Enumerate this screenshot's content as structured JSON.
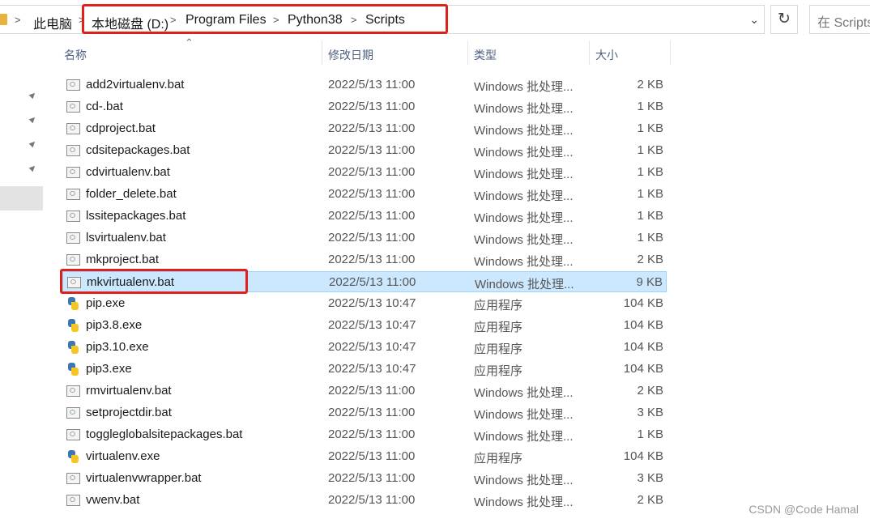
{
  "address": {
    "root": "此电脑",
    "crumbs": [
      "本地磁盘 (D:)",
      "Program Files",
      "Python38",
      "Scripts"
    ]
  },
  "search": {
    "placeholder": "在 Scripts"
  },
  "columns": {
    "name": "名称",
    "date": "修改日期",
    "type": "类型",
    "size": "大小"
  },
  "files": [
    {
      "name": "add2virtualenv.bat",
      "date": "2022/5/13 11:00",
      "type": "Windows 批处理...",
      "size": "2 KB",
      "icon": "bat-file-icon"
    },
    {
      "name": "cd-.bat",
      "date": "2022/5/13 11:00",
      "type": "Windows 批处理...",
      "size": "1 KB",
      "icon": "bat-file-icon"
    },
    {
      "name": "cdproject.bat",
      "date": "2022/5/13 11:00",
      "type": "Windows 批处理...",
      "size": "1 KB",
      "icon": "bat-file-icon"
    },
    {
      "name": "cdsitepackages.bat",
      "date": "2022/5/13 11:00",
      "type": "Windows 批处理...",
      "size": "1 KB",
      "icon": "bat-file-icon"
    },
    {
      "name": "cdvirtualenv.bat",
      "date": "2022/5/13 11:00",
      "type": "Windows 批处理...",
      "size": "1 KB",
      "icon": "bat-file-icon"
    },
    {
      "name": "folder_delete.bat",
      "date": "2022/5/13 11:00",
      "type": "Windows 批处理...",
      "size": "1 KB",
      "icon": "bat-file-icon"
    },
    {
      "name": "lssitepackages.bat",
      "date": "2022/5/13 11:00",
      "type": "Windows 批处理...",
      "size": "1 KB",
      "icon": "bat-file-icon"
    },
    {
      "name": "lsvirtualenv.bat",
      "date": "2022/5/13 11:00",
      "type": "Windows 批处理...",
      "size": "1 KB",
      "icon": "bat-file-icon"
    },
    {
      "name": "mkproject.bat",
      "date": "2022/5/13 11:00",
      "type": "Windows 批处理...",
      "size": "2 KB",
      "icon": "bat-file-icon"
    },
    {
      "name": "mkvirtualenv.bat",
      "date": "2022/5/13 11:00",
      "type": "Windows 批处理...",
      "size": "9 KB",
      "icon": "bat-file-icon",
      "selected": true
    },
    {
      "name": "pip.exe",
      "date": "2022/5/13 10:47",
      "type": "应用程序",
      "size": "104 KB",
      "icon": "python-exe-icon"
    },
    {
      "name": "pip3.8.exe",
      "date": "2022/5/13 10:47",
      "type": "应用程序",
      "size": "104 KB",
      "icon": "python-exe-icon"
    },
    {
      "name": "pip3.10.exe",
      "date": "2022/5/13 10:47",
      "type": "应用程序",
      "size": "104 KB",
      "icon": "python-exe-icon"
    },
    {
      "name": "pip3.exe",
      "date": "2022/5/13 10:47",
      "type": "应用程序",
      "size": "104 KB",
      "icon": "python-exe-icon"
    },
    {
      "name": "rmvirtualenv.bat",
      "date": "2022/5/13 11:00",
      "type": "Windows 批处理...",
      "size": "2 KB",
      "icon": "bat-file-icon"
    },
    {
      "name": "setprojectdir.bat",
      "date": "2022/5/13 11:00",
      "type": "Windows 批处理...",
      "size": "3 KB",
      "icon": "bat-file-icon"
    },
    {
      "name": "toggleglobalsitepackages.bat",
      "date": "2022/5/13 11:00",
      "type": "Windows 批处理...",
      "size": "1 KB",
      "icon": "bat-file-icon"
    },
    {
      "name": "virtualenv.exe",
      "date": "2022/5/13 11:00",
      "type": "应用程序",
      "size": "104 KB",
      "icon": "python-exe-icon"
    },
    {
      "name": "virtualenvwrapper.bat",
      "date": "2022/5/13 11:00",
      "type": "Windows 批处理...",
      "size": "3 KB",
      "icon": "bat-file-icon"
    },
    {
      "name": "vwenv.bat",
      "date": "2022/5/13 11:00",
      "type": "Windows 批处理...",
      "size": "2 KB",
      "icon": "bat-file-icon"
    }
  ],
  "watermark": "CSDN @Code Hamal",
  "colors": {
    "selection": "#cce8ff",
    "annotation": "#e0201b",
    "header_text": "#4d6082"
  }
}
